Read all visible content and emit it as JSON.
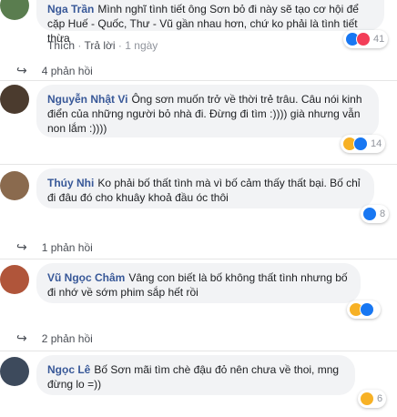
{
  "actions": {
    "like": "Thích",
    "reply": "Trả lời",
    "sep": "·"
  },
  "comments": [
    {
      "author": "Nga Trần",
      "text": "Mình nghĩ tình tiết ông Sơn bỏ đi này sẽ tạo cơ hội để cặp Huế - Quốc, Thư - Vũ gần nhau hơn, chứ ko phải là tình tiết thừa",
      "time": "1 ngày",
      "reaction_icons": [
        "like-icon",
        "love-icon"
      ],
      "reaction_count": "41",
      "replies_label": "4 phản hồi"
    },
    {
      "author": "Nguyễn Nhật Vi",
      "text": "Ông sơn muốn trở về thời trẻ trâu. Câu nói kinh điển của những người bỏ nhà đi. Đừng đi tìm :)))) già nhưng vẫn non lắm :))))",
      "reaction_icons": [
        "haha-icon",
        "like-icon"
      ],
      "reaction_count": "14"
    },
    {
      "author": "Thúy Nhi",
      "text": "Ko phải bố thất tình mà vì bố cảm thấy thất bại. Bố chỉ đi đâu đó cho khuây khoả đầu óc thôi",
      "reaction_icons": [
        "like-icon"
      ],
      "reaction_count": "8",
      "replies_label": "1 phản hồi"
    },
    {
      "author": "Vũ Ngọc Châm",
      "text": "Vâng con biết là bố không thất tình nhưng bố đi nhớ về sớm phim sắp hết rồi",
      "reaction_icons": [
        "haha-icon",
        "like-icon"
      ],
      "reaction_count": "",
      "replies_label": "2 phản hồi"
    },
    {
      "author": "Ngọc Lê",
      "text": "Bố Sơn mãi tìm chè đậu đỏ nên chưa về thoi, mng đừng lo =))",
      "reaction_icons": [
        "haha-icon"
      ],
      "reaction_count": "6"
    }
  ]
}
